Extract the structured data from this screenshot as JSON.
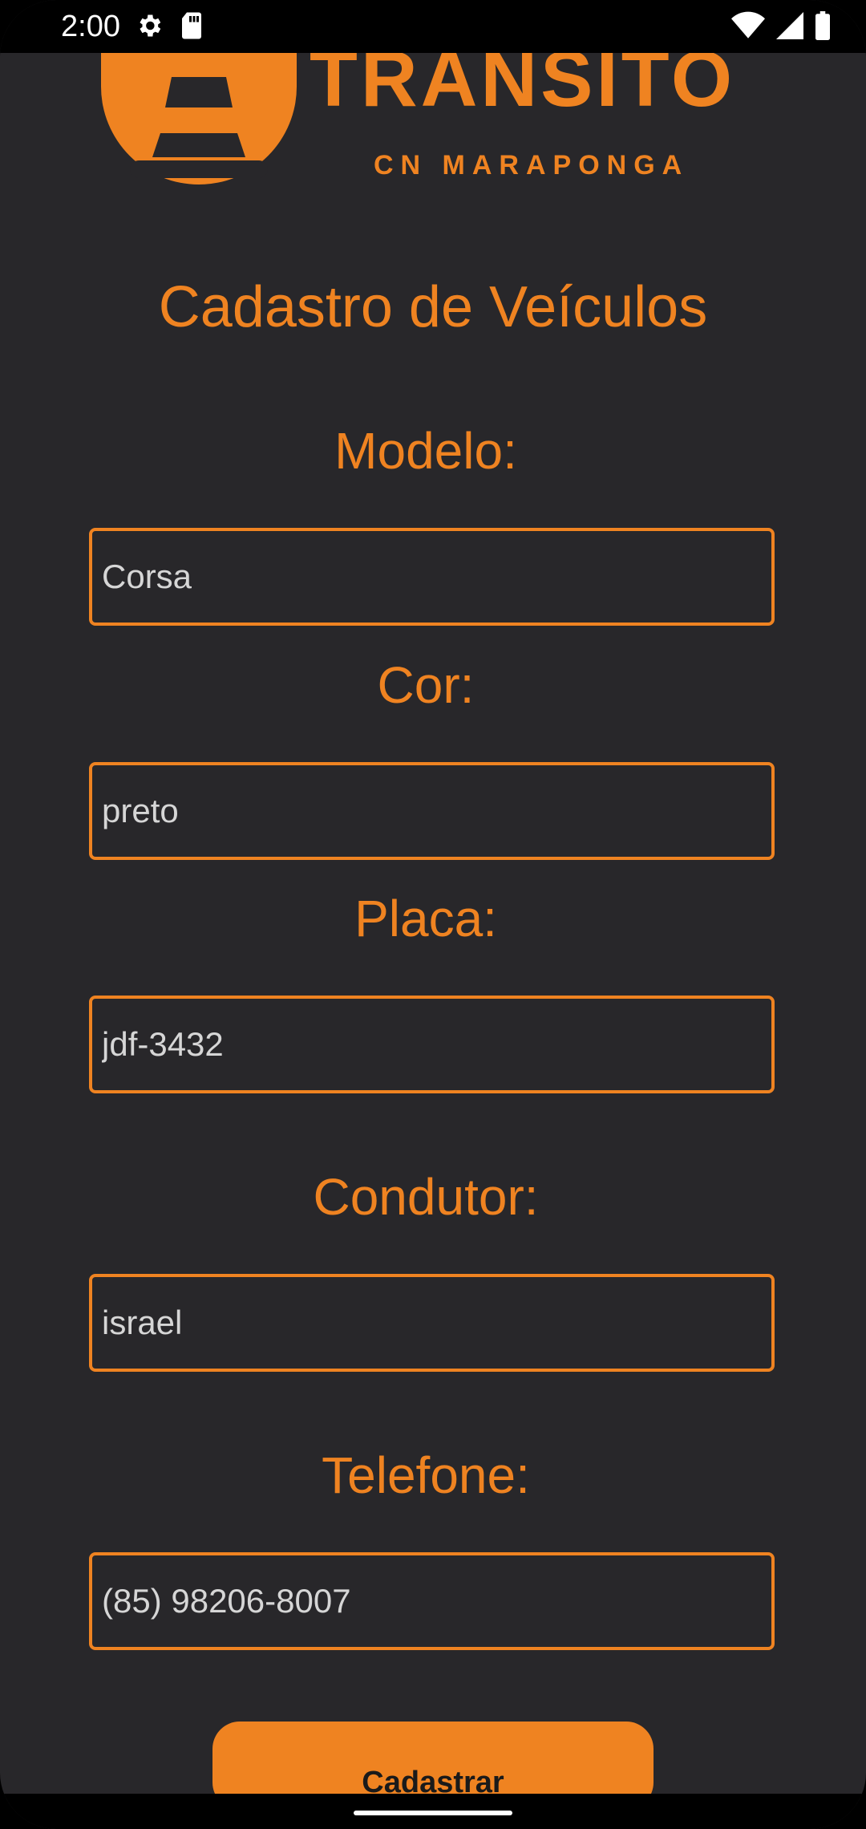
{
  "status_bar": {
    "time": "2:00",
    "icons_left": [
      "gear-icon",
      "sd-card-icon"
    ],
    "icons_right": [
      "wifi-icon",
      "signal-icon",
      "battery-icon"
    ]
  },
  "logo": {
    "brand": "TRANSITO",
    "subtitle": "CN MARAPONGA",
    "icon": "traffic-cone-icon"
  },
  "page": {
    "title": "Cadastro de Veículos"
  },
  "form": {
    "fields": [
      {
        "label": "Modelo:",
        "value": "Corsa"
      },
      {
        "label": "Cor:",
        "value": "preto"
      },
      {
        "label": "Placa:",
        "value": "jdf-3432"
      },
      {
        "label": "Condutor:",
        "value": "israel"
      },
      {
        "label": "Telefone:",
        "value": "(85) 98206-8007"
      }
    ],
    "submit_label": "Cadastrar"
  },
  "colors": {
    "accent": "#ef8321",
    "background": "#28272a",
    "input_text": "#d6d6d6"
  }
}
